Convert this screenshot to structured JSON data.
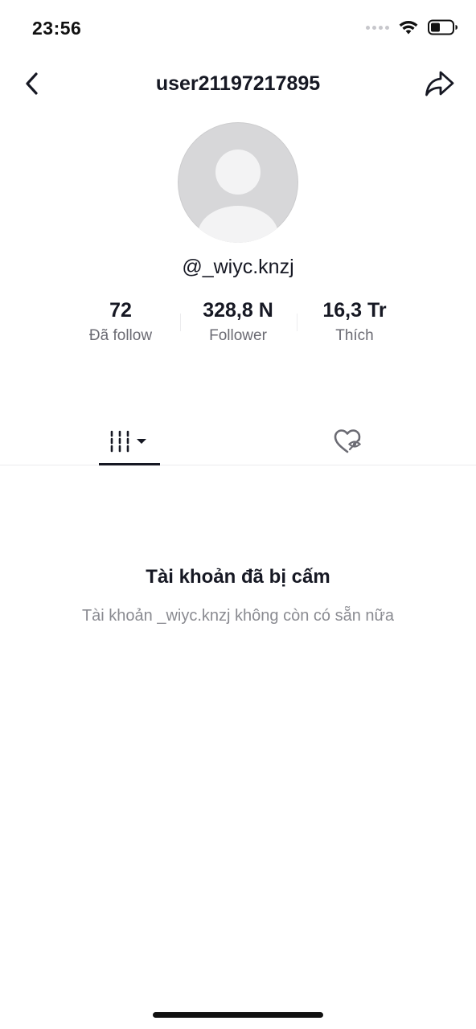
{
  "status_bar": {
    "time": "23:56",
    "icons": [
      "signal-dots-icon",
      "wifi-icon",
      "battery-icon"
    ]
  },
  "header": {
    "title": "user21197217895",
    "back_icon": "chevron-left-icon",
    "share_icon": "share-arrow-icon"
  },
  "profile": {
    "avatar_icon": "default-avatar-icon",
    "username": "@_wiyc.knzj"
  },
  "stats": [
    {
      "value": "72",
      "label": "Đã follow"
    },
    {
      "value": "328,8 N",
      "label": "Follower"
    },
    {
      "value": "16,3 Tr",
      "label": "Thích"
    }
  ],
  "tabs": [
    {
      "icon": "video-grid-dropdown-icon",
      "active": true
    },
    {
      "icon": "liked-hidden-heart-icon",
      "active": false
    }
  ],
  "banned": {
    "title": "Tài khoản đã bị cấm",
    "description": "Tài khoản _wiyc.knzj không còn có sẵn nữa"
  },
  "colors": {
    "text_primary": "#161823",
    "text_secondary": "#6b6b73",
    "text_muted": "#8a8b91",
    "avatar_bg": "#d7d7d9",
    "divider": "#ececee"
  }
}
